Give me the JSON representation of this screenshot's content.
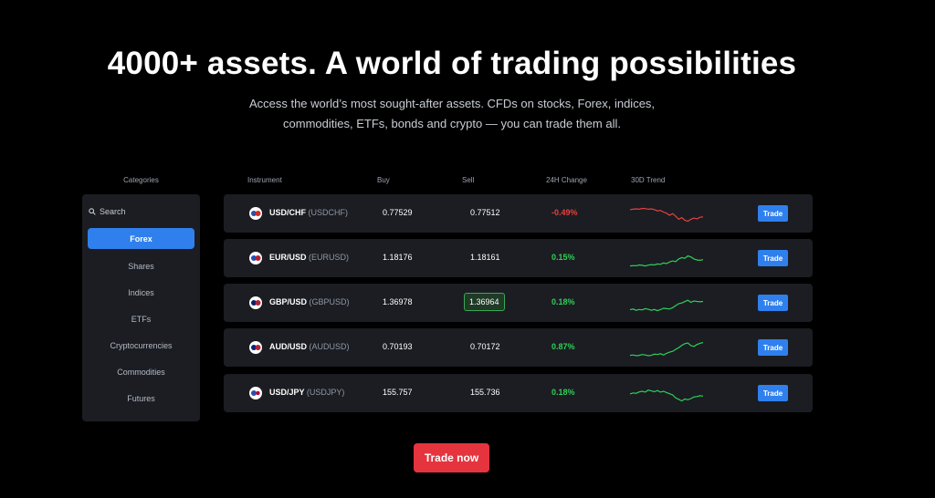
{
  "hero": {
    "title": "4000+ assets. A world of trading possibilities",
    "subtitle_line1": "Access the world’s most sought-after assets. CFDs on stocks, Forex, indices,",
    "subtitle_line2": "commodities, ETFs, bonds and crypto — you can trade them all."
  },
  "categories": {
    "heading": "Categories",
    "search_label": "Search",
    "items": [
      "Forex",
      "Shares",
      "Indices",
      "ETFs",
      "Cryptocurrencies",
      "Commodities",
      "Futures"
    ],
    "active": "Forex"
  },
  "table": {
    "headers": {
      "instrument": "Instrument",
      "buy": "Buy",
      "sell": "Sell",
      "change": "24H Change",
      "trend": "30D Trend"
    },
    "trade_label": "Trade",
    "rows": [
      {
        "name": "USD/CHF",
        "code": "(USDCHF)",
        "buy": "0.77529",
        "sell": "0.77512",
        "change": "-0.49%",
        "direction": "down",
        "sell_highlighted": false,
        "trend": [
          0.78,
          0.8,
          0.82,
          0.8,
          0.84,
          0.83,
          0.8,
          0.82,
          0.78,
          0.72,
          0.74,
          0.66,
          0.6,
          0.5,
          0.58,
          0.45,
          0.3,
          0.38,
          0.25,
          0.2,
          0.3,
          0.36,
          0.32,
          0.4,
          0.42
        ]
      },
      {
        "name": "EUR/USD",
        "code": "(EURUSD)",
        "buy": "1.18176",
        "sell": "1.18161",
        "change": "0.15%",
        "direction": "up",
        "sell_highlighted": false,
        "trend": [
          0.2,
          0.22,
          0.21,
          0.25,
          0.23,
          0.2,
          0.24,
          0.27,
          0.25,
          0.3,
          0.28,
          0.35,
          0.32,
          0.4,
          0.45,
          0.42,
          0.55,
          0.62,
          0.58,
          0.7,
          0.65,
          0.55,
          0.5,
          0.48,
          0.52
        ]
      },
      {
        "name": "GBP/USD",
        "code": "(GBPUSD)",
        "buy": "1.36978",
        "sell": "1.36964",
        "change": "0.18%",
        "direction": "up",
        "sell_highlighted": true,
        "trend": [
          0.25,
          0.28,
          0.22,
          0.26,
          0.24,
          0.3,
          0.27,
          0.22,
          0.26,
          0.2,
          0.25,
          0.32,
          0.3,
          0.28,
          0.35,
          0.45,
          0.55,
          0.58,
          0.65,
          0.72,
          0.62,
          0.68,
          0.66,
          0.64,
          0.66
        ]
      },
      {
        "name": "AUD/USD",
        "code": "(AUDUSD)",
        "buy": "0.70193",
        "sell": "0.70172",
        "change": "0.87%",
        "direction": "up",
        "sell_highlighted": false,
        "trend": [
          0.2,
          0.22,
          0.18,
          0.2,
          0.24,
          0.22,
          0.18,
          0.2,
          0.26,
          0.24,
          0.28,
          0.22,
          0.3,
          0.36,
          0.4,
          0.5,
          0.58,
          0.7,
          0.78,
          0.82,
          0.68,
          0.64,
          0.74,
          0.8,
          0.84
        ]
      },
      {
        "name": "USD/JPY",
        "code": "(USDJPY)",
        "buy": "155.757",
        "sell": "155.736",
        "change": "0.18%",
        "direction": "up",
        "sell_highlighted": false,
        "trend": [
          0.55,
          0.6,
          0.58,
          0.65,
          0.68,
          0.64,
          0.74,
          0.7,
          0.66,
          0.72,
          0.64,
          0.68,
          0.62,
          0.56,
          0.5,
          0.35,
          0.28,
          0.2,
          0.3,
          0.26,
          0.32,
          0.4,
          0.42,
          0.46,
          0.44
        ]
      }
    ]
  },
  "cta": {
    "label": "Trade now"
  },
  "colors": {
    "accent": "#2f80ed",
    "up": "#2fcf57",
    "down": "#e5413f",
    "cta": "#e5343e"
  }
}
